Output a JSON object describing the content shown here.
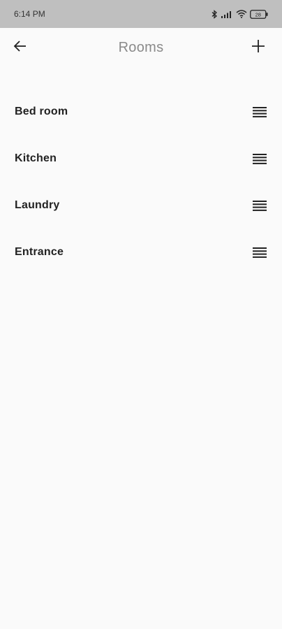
{
  "status_bar": {
    "time": "6:14 PM",
    "battery_level": "28",
    "icons": [
      "bluetooth-icon",
      "signal-icon",
      "wifi-icon",
      "battery-icon"
    ]
  },
  "app_bar": {
    "title": "Rooms",
    "back_icon": "arrow-left-icon",
    "add_icon": "plus-icon"
  },
  "rooms": [
    {
      "name": "Bed room"
    },
    {
      "name": "Kitchen"
    },
    {
      "name": "Laundry"
    },
    {
      "name": "Entrance"
    }
  ],
  "colors": {
    "status_bar_bg": "#bfbfbf",
    "page_bg": "#fafafa",
    "title": "#8a8a8a",
    "text": "#222222"
  }
}
